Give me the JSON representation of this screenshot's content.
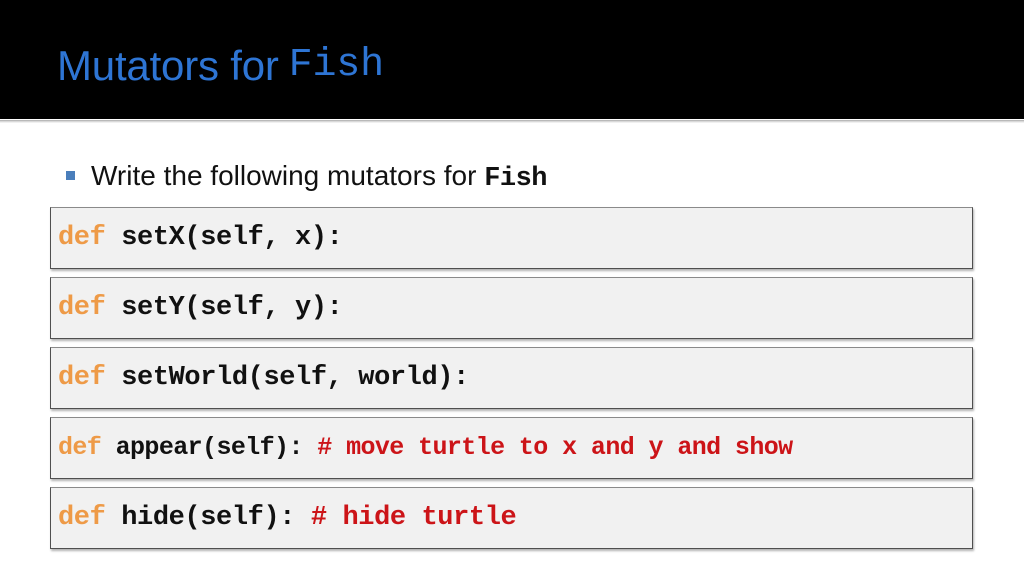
{
  "slide": {
    "title_plain": "Mutators for",
    "title_mono": "Fish",
    "accent_blue": "#2E75D4",
    "bullet_marker_color": "#4A7EBB",
    "header_background": "#000000",
    "body_background": "#ffffff"
  },
  "bullet": {
    "text_before": "Write the following mutators for",
    "text_mono": "Fish",
    "marker_icon": "square-bullet-icon"
  },
  "code_blocks": [
    {
      "keyword": "def",
      "signature": " setX(self, x):",
      "comment": "",
      "keyword_color": "#EE9A47",
      "comment_color": "#CC1418",
      "box_background": "#F1F1F1",
      "box_border": "#4F4F4F"
    },
    {
      "keyword": "def",
      "signature": " setY(self, y):",
      "comment": "",
      "keyword_color": "#EE9A47",
      "comment_color": "#CC1418",
      "box_background": "#F1F1F1",
      "box_border": "#4F4F4F"
    },
    {
      "keyword": "def",
      "signature": " setWorld(self, world):",
      "comment": "",
      "keyword_color": "#EE9A47",
      "comment_color": "#CC1418",
      "box_background": "#F1F1F1",
      "box_border": "#4F4F4F"
    },
    {
      "keyword": "def",
      "signature": " appear(self): ",
      "comment": "# move turtle to x and y and show",
      "keyword_color": "#EE9A47",
      "comment_color": "#CC1418",
      "box_background": "#F1F1F1",
      "box_border": "#4F4F4F"
    },
    {
      "keyword": "def",
      "signature": " hide(self): ",
      "comment": "# hide turtle",
      "keyword_color": "#EE9A47",
      "comment_color": "#CC1418",
      "box_background": "#F1F1F1",
      "box_border": "#4F4F4F"
    }
  ]
}
